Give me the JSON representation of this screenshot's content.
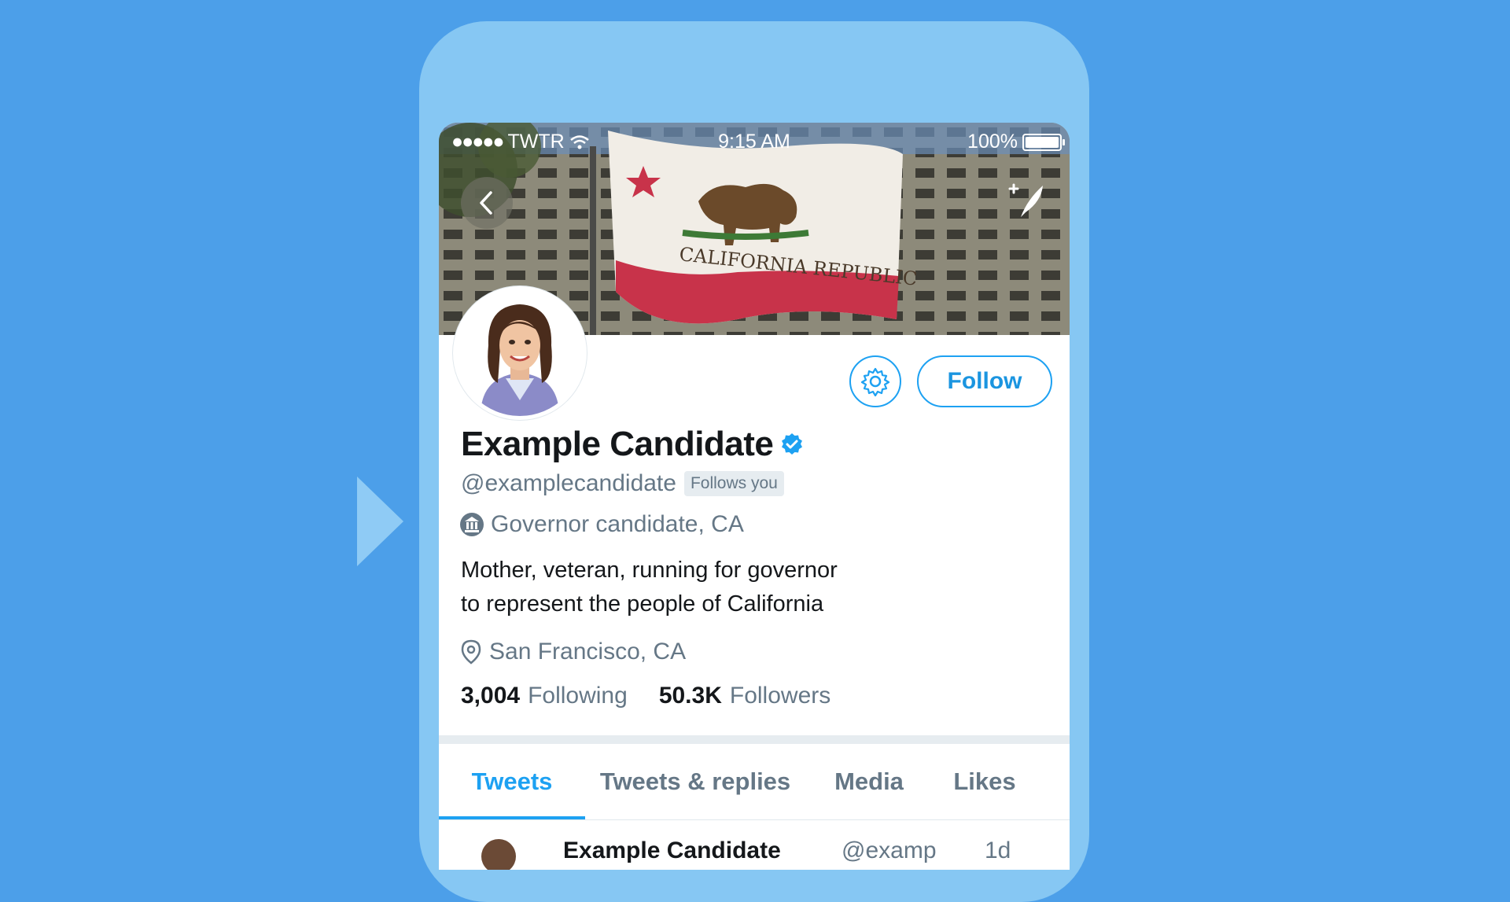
{
  "status_bar": {
    "carrier": "TWTR",
    "time": "9:15 AM",
    "battery": "100%"
  },
  "colors": {
    "background": "#4c9fe9",
    "phone": "#86c7f3",
    "accent": "#1da1f2",
    "text_primary": "#14171a",
    "text_secondary": "#657786"
  },
  "header": {
    "back_icon": "chevron-left-icon",
    "compose_icon": "compose-feather-icon",
    "banner_flag_text": "CALIFORNIA REPUBLIC"
  },
  "actions": {
    "settings_icon": "gear-icon",
    "follow_label": "Follow"
  },
  "profile": {
    "name": "Example Candidate",
    "verified_icon": "verified-badge-icon",
    "handle": "@examplecandidate",
    "follows_you": "Follows you",
    "label_icon": "government-building-icon",
    "label": "Governor candidate, CA",
    "bio_line1": "Mother, veteran, running for governor",
    "bio_line2": "to represent the people of California",
    "location_icon": "location-pin-icon",
    "location": "San Francisco, CA",
    "following_count": "3,004",
    "following_label": "Following",
    "followers_count": "50.3K",
    "followers_label": "Followers"
  },
  "tabs": [
    {
      "label": "Tweets",
      "active": true
    },
    {
      "label": "Tweets & replies",
      "active": false
    },
    {
      "label": "Media",
      "active": false
    },
    {
      "label": "Likes",
      "active": false
    }
  ],
  "tweet_preview": {
    "name": "Example Candidate",
    "handle": "@examp",
    "time": "1d"
  }
}
